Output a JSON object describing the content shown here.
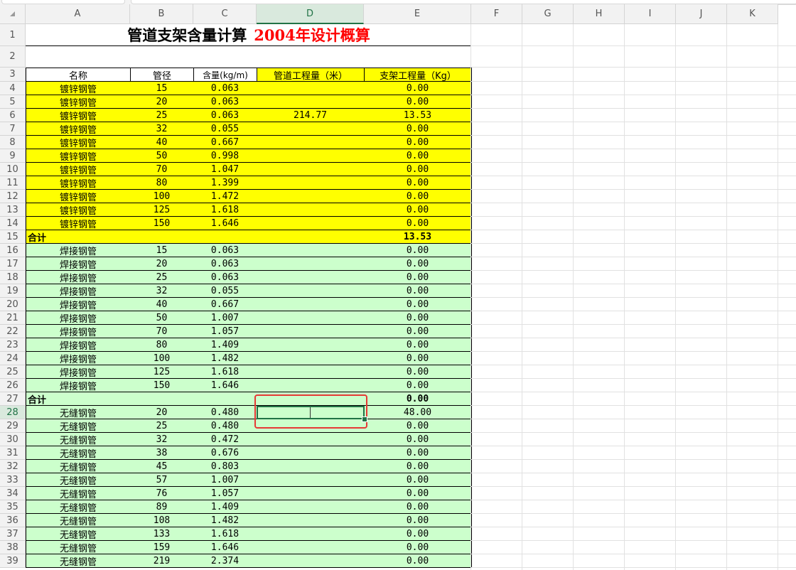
{
  "columns": [
    "A",
    "B",
    "C",
    "D",
    "E",
    "F",
    "G",
    "H",
    "I",
    "J",
    "K"
  ],
  "active_column": "D",
  "active_row": 28,
  "title": {
    "main": "管道支架含量计算",
    "red": "2004年设计概算"
  },
  "headers": {
    "name": "名称",
    "diameter": "管径",
    "content": "含量(kg/m)",
    "pipe_qty": "管道工程量（米）",
    "support_qty": "支架工程量（Kg）"
  },
  "colors": {
    "yellow": "#ffff00",
    "green": "#ccffcc",
    "red_title": "#ff0000",
    "selection": "#217346",
    "highlight_box": "#e53935"
  },
  "rows": [
    {
      "r": 4,
      "name": "镀锌钢管",
      "dn": "15",
      "content": "0.063",
      "pipe": "",
      "support": "0.00",
      "band": "yellow"
    },
    {
      "r": 5,
      "name": "镀锌钢管",
      "dn": "20",
      "content": "0.063",
      "pipe": "",
      "support": "0.00",
      "band": "yellow"
    },
    {
      "r": 6,
      "name": "镀锌钢管",
      "dn": "25",
      "content": "0.063",
      "pipe": "214.77",
      "support": "13.53",
      "band": "yellow"
    },
    {
      "r": 7,
      "name": "镀锌钢管",
      "dn": "32",
      "content": "0.055",
      "pipe": "",
      "support": "0.00",
      "band": "yellow"
    },
    {
      "r": 8,
      "name": "镀锌钢管",
      "dn": "40",
      "content": "0.667",
      "pipe": "",
      "support": "0.00",
      "band": "yellow"
    },
    {
      "r": 9,
      "name": "镀锌钢管",
      "dn": "50",
      "content": "0.998",
      "pipe": "",
      "support": "0.00",
      "band": "yellow"
    },
    {
      "r": 10,
      "name": "镀锌钢管",
      "dn": "70",
      "content": "1.047",
      "pipe": "",
      "support": "0.00",
      "band": "yellow"
    },
    {
      "r": 11,
      "name": "镀锌钢管",
      "dn": "80",
      "content": "1.399",
      "pipe": "",
      "support": "0.00",
      "band": "yellow"
    },
    {
      "r": 12,
      "name": "镀锌钢管",
      "dn": "100",
      "content": "1.472",
      "pipe": "",
      "support": "0.00",
      "band": "yellow"
    },
    {
      "r": 13,
      "name": "镀锌钢管",
      "dn": "125",
      "content": "1.618",
      "pipe": "",
      "support": "0.00",
      "band": "yellow"
    },
    {
      "r": 14,
      "name": "镀锌钢管",
      "dn": "150",
      "content": "1.646",
      "pipe": "",
      "support": "0.00",
      "band": "yellow"
    },
    {
      "r": 15,
      "total": true,
      "name": "合计",
      "support": "13.53",
      "band": "yellow"
    },
    {
      "r": 16,
      "name": "焊接钢管",
      "dn": "15",
      "content": "0.063",
      "pipe": "",
      "support": "0.00",
      "band": "green"
    },
    {
      "r": 17,
      "name": "焊接钢管",
      "dn": "20",
      "content": "0.063",
      "pipe": "",
      "support": "0.00",
      "band": "green"
    },
    {
      "r": 18,
      "name": "焊接钢管",
      "dn": "25",
      "content": "0.063",
      "pipe": "",
      "support": "0.00",
      "band": "green"
    },
    {
      "r": 19,
      "name": "焊接钢管",
      "dn": "32",
      "content": "0.055",
      "pipe": "",
      "support": "0.00",
      "band": "green"
    },
    {
      "r": 20,
      "name": "焊接钢管",
      "dn": "40",
      "content": "0.667",
      "pipe": "",
      "support": "0.00",
      "band": "green"
    },
    {
      "r": 21,
      "name": "焊接钢管",
      "dn": "50",
      "content": "1.007",
      "pipe": "",
      "support": "0.00",
      "band": "green"
    },
    {
      "r": 22,
      "name": "焊接钢管",
      "dn": "70",
      "content": "1.057",
      "pipe": "",
      "support": "0.00",
      "band": "green"
    },
    {
      "r": 23,
      "name": "焊接钢管",
      "dn": "80",
      "content": "1.409",
      "pipe": "",
      "support": "0.00",
      "band": "green"
    },
    {
      "r": 24,
      "name": "焊接钢管",
      "dn": "100",
      "content": "1.482",
      "pipe": "",
      "support": "0.00",
      "band": "green"
    },
    {
      "r": 25,
      "name": "焊接钢管",
      "dn": "125",
      "content": "1.618",
      "pipe": "",
      "support": "0.00",
      "band": "green"
    },
    {
      "r": 26,
      "name": "焊接钢管",
      "dn": "150",
      "content": "1.646",
      "pipe": "",
      "support": "0.00",
      "band": "green"
    },
    {
      "r": 27,
      "total": true,
      "name": "合计",
      "support": "0.00",
      "band": "green"
    },
    {
      "r": 28,
      "name": "无缝钢管",
      "dn": "20",
      "content": "0.480",
      "pipe": "",
      "support": "48.00",
      "band": "green"
    },
    {
      "r": 29,
      "name": "无缝钢管",
      "dn": "25",
      "content": "0.480",
      "pipe": "",
      "support": "0.00",
      "band": "green"
    },
    {
      "r": 30,
      "name": "无缝钢管",
      "dn": "32",
      "content": "0.472",
      "pipe": "",
      "support": "0.00",
      "band": "green"
    },
    {
      "r": 31,
      "name": "无缝钢管",
      "dn": "38",
      "content": "0.676",
      "pipe": "",
      "support": "0.00",
      "band": "green"
    },
    {
      "r": 32,
      "name": "无缝钢管",
      "dn": "45",
      "content": "0.803",
      "pipe": "",
      "support": "0.00",
      "band": "green"
    },
    {
      "r": 33,
      "name": "无缝钢管",
      "dn": "57",
      "content": "1.007",
      "pipe": "",
      "support": "0.00",
      "band": "green"
    },
    {
      "r": 34,
      "name": "无缝钢管",
      "dn": "76",
      "content": "1.057",
      "pipe": "",
      "support": "0.00",
      "band": "green"
    },
    {
      "r": 35,
      "name": "无缝钢管",
      "dn": "89",
      "content": "1.409",
      "pipe": "",
      "support": "0.00",
      "band": "green"
    },
    {
      "r": 36,
      "name": "无缝钢管",
      "dn": "108",
      "content": "1.482",
      "pipe": "",
      "support": "0.00",
      "band": "green"
    },
    {
      "r": 37,
      "name": "无缝钢管",
      "dn": "133",
      "content": "1.618",
      "pipe": "",
      "support": "0.00",
      "band": "green"
    },
    {
      "r": 38,
      "name": "无缝钢管",
      "dn": "159",
      "content": "1.646",
      "pipe": "",
      "support": "0.00",
      "band": "green"
    },
    {
      "r": 39,
      "name": "无缝钢管",
      "dn": "219",
      "content": "2.374",
      "pipe": "",
      "support": "0.00",
      "band": "green"
    }
  ]
}
